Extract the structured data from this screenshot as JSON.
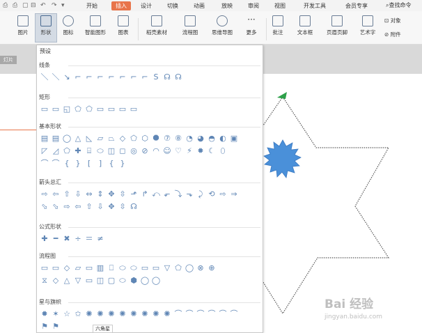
{
  "menubar": {
    "tabs": [
      "开始",
      "插入",
      "设计",
      "切换",
      "动画",
      "放映",
      "审阅",
      "视图",
      "开发工具",
      "会员专享"
    ],
    "active_tab": "插入",
    "search_label": "查找命令"
  },
  "ribbon": {
    "buttons": [
      "图片",
      "形状",
      "图标",
      "智能图形",
      "图表",
      "稻壳素材",
      "流程图",
      "思维导图",
      "更多",
      "批注",
      "文本框",
      "页眉页脚",
      "艺术字",
      "对象",
      "附件"
    ]
  },
  "doc_tab": "灯片",
  "dropdown": {
    "header": "预设",
    "categories": [
      {
        "title": "线条",
        "rows": [
          [
            "＼",
            "＼",
            "↘",
            "⌐",
            "⌐",
            "⌐",
            "⌐",
            "⌐",
            "⌐",
            "⌐",
            "S",
            "☊",
            "☊"
          ]
        ]
      },
      {
        "title": "矩形",
        "rows": [
          [
            "▭",
            "▭",
            "◱",
            "⬠",
            "⬠",
            "▭",
            "▭",
            "▭",
            "▭"
          ]
        ]
      },
      {
        "title": "基本形状",
        "rows": [
          [
            "▤",
            "▤",
            "◯",
            "△",
            "◺",
            "▱",
            "⏢",
            "◇",
            "⬠",
            "⬡",
            "⯃",
            "⑦",
            "⑧",
            "◔",
            "◕",
            "◓",
            "◐",
            "▣"
          ],
          [
            "◸",
            "◿",
            "⬠",
            "✚",
            "⌸",
            "⬭",
            "◫",
            "◻",
            "◎",
            "⊘",
            "◠",
            "☺",
            "♡",
            "⚡",
            "✹",
            "☾",
            "⬯"
          ],
          [
            "⌒",
            "⌒",
            "{",
            "}",
            "[",
            "]",
            "{",
            "}"
          ]
        ]
      },
      {
        "title": "箭头总汇",
        "rows": [
          [
            "⇨",
            "⇦",
            "⇧",
            "⇩",
            "⇔",
            "⇕",
            "✥",
            "⇳",
            "⬏",
            "↱",
            "⤺",
            "⬐",
            "⤵",
            "⬎",
            "⤸",
            "⟲",
            "⇨",
            "⇒"
          ],
          [
            "⬂",
            "⬂",
            "⇨",
            "⇦",
            "⇧",
            "⇩",
            "✥",
            "⇳",
            "☊"
          ]
        ]
      },
      {
        "title": "公式形状",
        "rows": [
          [
            "✚",
            "━",
            "✖",
            "÷",
            "＝",
            "≠"
          ]
        ]
      },
      {
        "title": "流程图",
        "rows": [
          [
            "▭",
            "▭",
            "◇",
            "▱",
            "▭",
            "▥",
            "⎕",
            "⬭",
            "⬭",
            "▭",
            "▭",
            "▽",
            "⬠",
            "◯",
            "⊗",
            "⊕"
          ],
          [
            "⧖",
            "◇",
            "△",
            "▽",
            "▭",
            "◫",
            "▢",
            "⬭",
            "⬢",
            "◯",
            "◯"
          ]
        ]
      },
      {
        "title": "星与旗帜",
        "rows": [
          [
            "✹",
            "✶",
            "☆",
            "✩",
            "✺",
            "✺",
            "✺",
            "✺",
            "✺",
            "✺",
            "✺",
            "✺",
            "⌒",
            "⌒",
            "⌒",
            "⌒",
            "⌒",
            "⌒"
          ],
          [
            "⚑",
            "⚑"
          ]
        ]
      }
    ],
    "tooltip": "六角星"
  },
  "colors": {
    "accent": "#e8744a",
    "shape_blue": "#4a90d9",
    "handle_green": "#2ea04a",
    "icon_blue": "#5f86b5"
  },
  "watermark": "Bai 经验",
  "watermark_sub": "jingyan.baidu.com"
}
